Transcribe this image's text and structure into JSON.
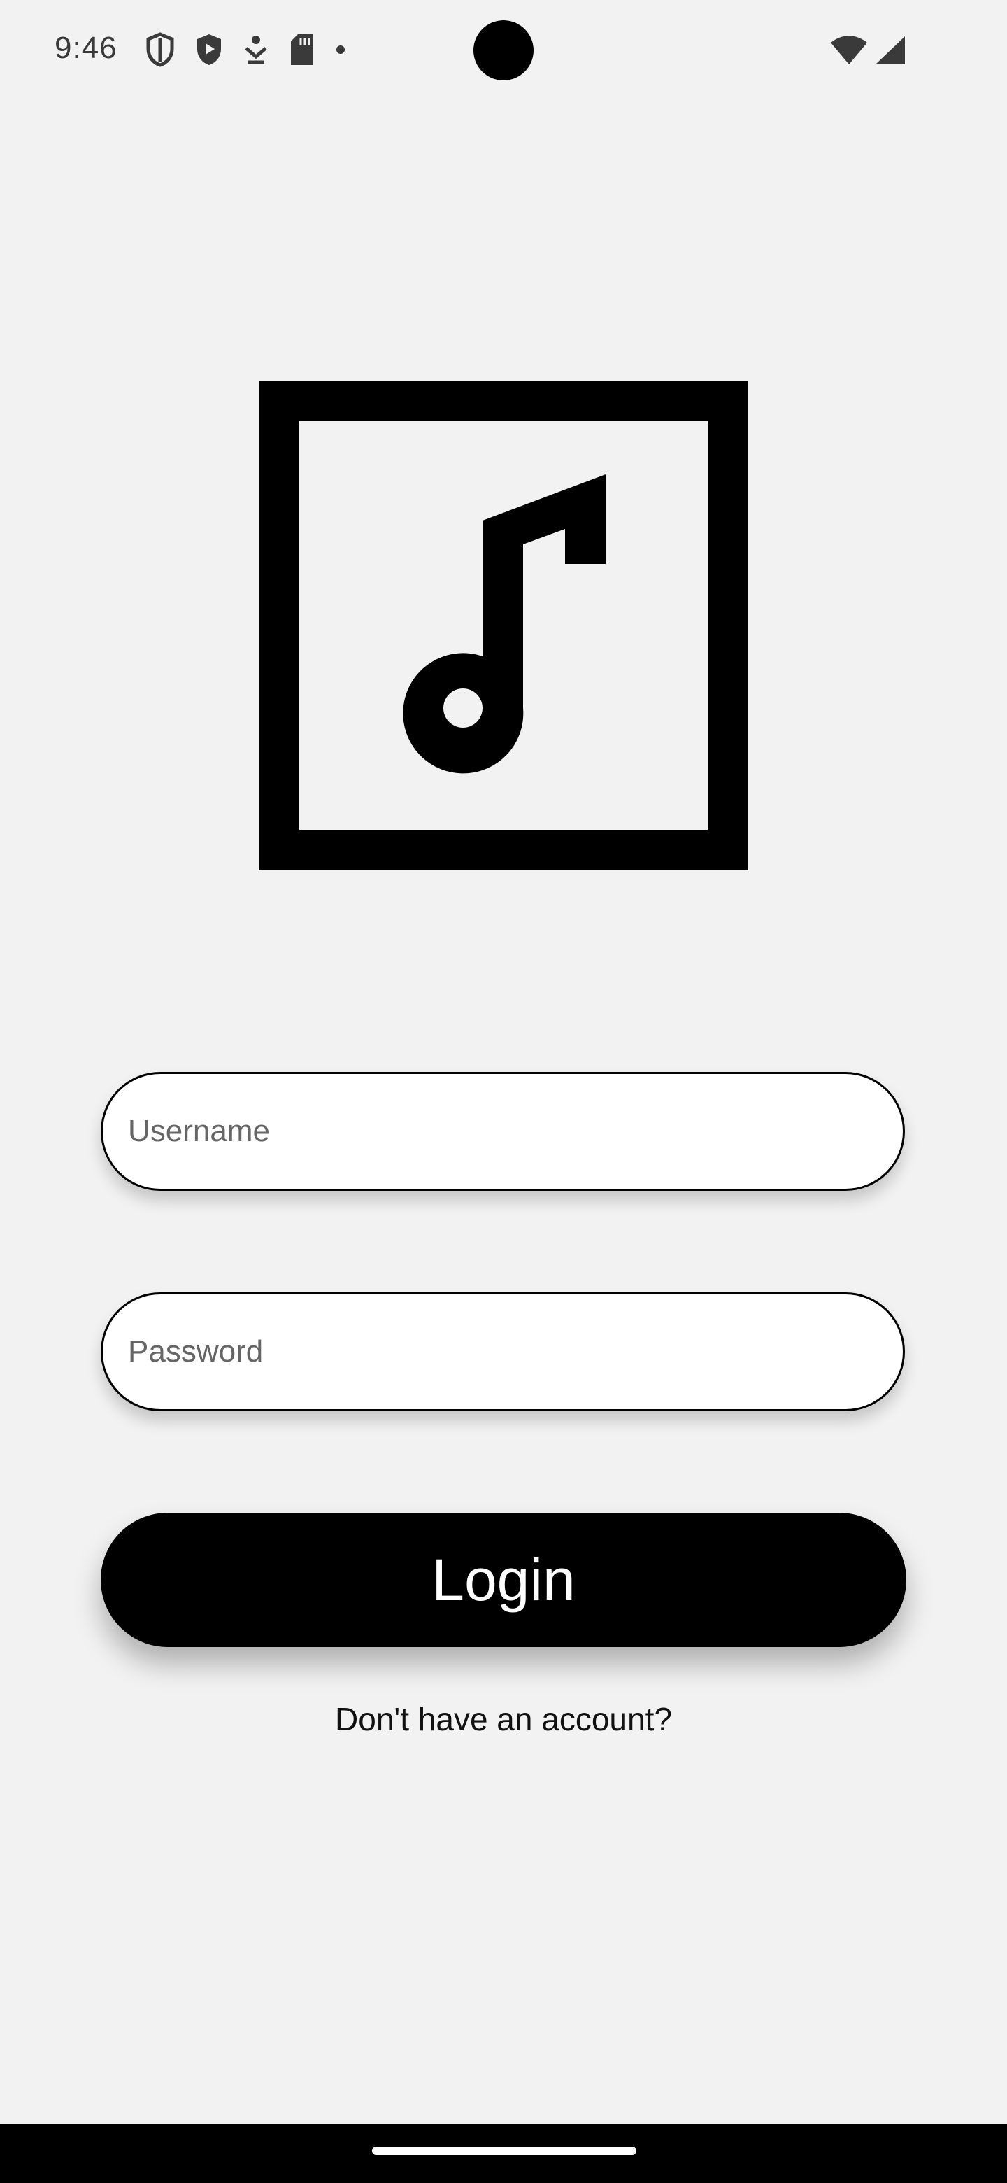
{
  "status_bar": {
    "time": "9:46",
    "left_icons": [
      "shield-icon",
      "play-shield-icon",
      "download-icon",
      "sd-card-icon",
      "dot-icon"
    ],
    "right_icons": [
      "wifi-icon",
      "cell-signal-icon"
    ]
  },
  "logo": {
    "icon": "music-note-icon"
  },
  "form": {
    "username_placeholder": "Username",
    "password_placeholder": "Password",
    "login_label": "Login",
    "signup_prompt": "Don't have an account?"
  },
  "colors": {
    "background": "#f2f2f2",
    "accent": "#000000",
    "field_background": "#ffffff",
    "button_text": "#ffffff"
  }
}
